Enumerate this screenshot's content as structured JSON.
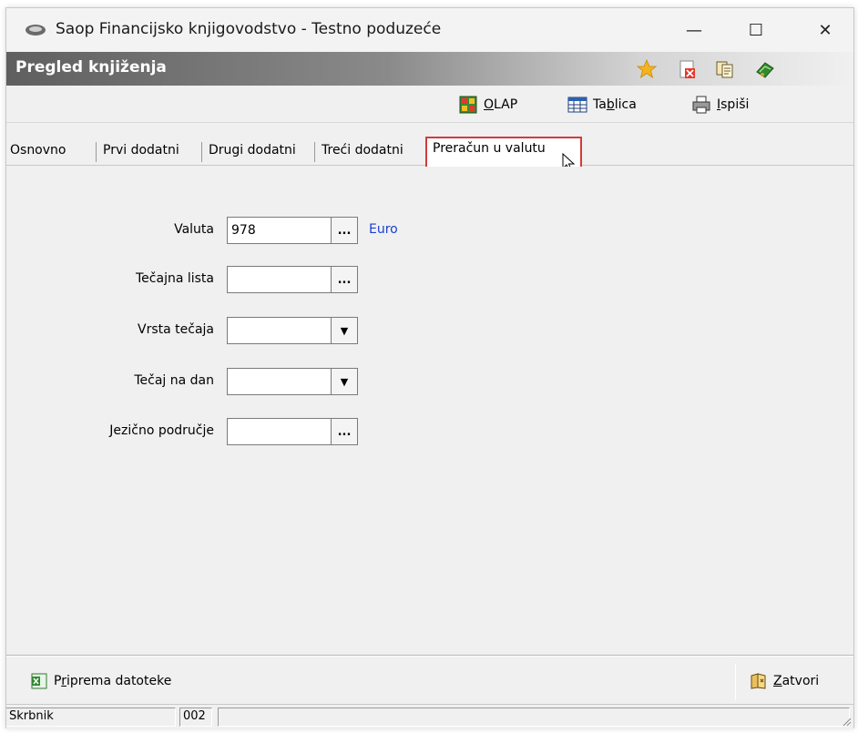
{
  "window": {
    "title": "Saop Financijsko knjigovodstvo - Testno poduzeće",
    "minimize_glyph": "—",
    "maximize_glyph": "☐",
    "close_glyph": "✕"
  },
  "header": {
    "title": "Pregled knjiženja",
    "icons": [
      "star-icon",
      "document-remove-icon",
      "pages-icon",
      "book-icon"
    ]
  },
  "toolbar": {
    "olap": {
      "prefix": "",
      "underlined": "O",
      "rest": "LAP",
      "icon": "olap-cube-icon"
    },
    "tablica": {
      "prefix": "Ta",
      "underlined": "b",
      "rest": "lica",
      "icon": "table-icon"
    },
    "ispisi": {
      "prefix": "",
      "underlined": "I",
      "rest": "spiši",
      "icon": "printer-icon"
    }
  },
  "tabs": [
    {
      "label": "Osnovno"
    },
    {
      "label": "Prvi dodatni"
    },
    {
      "label": "Drugi dodatni"
    },
    {
      "label": "Treći dodatni"
    },
    {
      "label": "Preračun u valutu",
      "active": true
    }
  ],
  "form": {
    "valuta": {
      "label": "Valuta",
      "value": "978",
      "description": "Euro",
      "button": "..."
    },
    "tecajna_lista": {
      "label": "Tečajna lista",
      "value": "",
      "button": "..."
    },
    "vrsta_tecaja": {
      "label": "Vrsta tečaja",
      "value": "",
      "button": "▼"
    },
    "tecaj_na_dan": {
      "label": "Tečaj na dan",
      "value": "",
      "button": "▼"
    },
    "jezicno_podrucje": {
      "label": "Jezično područje",
      "value": "",
      "button": "..."
    }
  },
  "bottom": {
    "priprema": {
      "prefix": "P",
      "underlined": "r",
      "rest": "iprema datoteke",
      "icon": "excel-icon"
    },
    "zatvori": {
      "prefix": "",
      "underlined": "Z",
      "rest": "atvori",
      "icon": "close-book-icon"
    }
  },
  "status": {
    "user": "Skrbnik",
    "code": "002",
    "extra": ""
  },
  "colors": {
    "accent_highlight": "#d23b3b",
    "link_blue": "#1a3fd0",
    "header_dark": "#5f5f5f"
  }
}
